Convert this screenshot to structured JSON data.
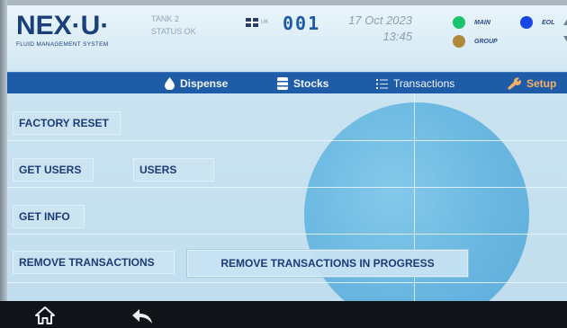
{
  "header": {
    "logo_text": "NEX·U·",
    "logo_tagline": "FLUID MANAGEMENT SYSTEM",
    "tank_name": "TANK 2",
    "tank_status": "STATUS OK",
    "language_code": "UK",
    "counter": "001",
    "date": "17 Oct 2023",
    "time": "13:45",
    "indicators": [
      {
        "label": "MAIN",
        "color": "#19c46a"
      },
      {
        "label": "GROUP",
        "color": "#b08a3a"
      },
      {
        "label": "EOL",
        "color": "#1846e6"
      }
    ]
  },
  "nav": {
    "items": [
      {
        "label": "Dispense",
        "icon": "drop-icon"
      },
      {
        "label": "Stocks",
        "icon": "barrel-icon"
      },
      {
        "label": "Transactions",
        "icon": "list-icon"
      },
      {
        "label": "Setup",
        "icon": "wrench-icon"
      }
    ],
    "active_color": "#f5b165"
  },
  "content": {
    "factory_reset": "FACTORY RESET",
    "get_users": "GET USERS",
    "users": "USERS",
    "get_info": "GET INFO",
    "remove_transactions": "REMOVE TRANSACTIONS",
    "remove_transactions_in_progress": "REMOVE TRANSACTIONS IN PROGRESS"
  },
  "bottom_bar": {
    "home_icon": "home-icon",
    "back_icon": "back-arrow-icon"
  },
  "colors": {
    "nav_bar": "#1f5ca8",
    "brand": "#1b3f7a",
    "button_text": "#1c3a78"
  }
}
